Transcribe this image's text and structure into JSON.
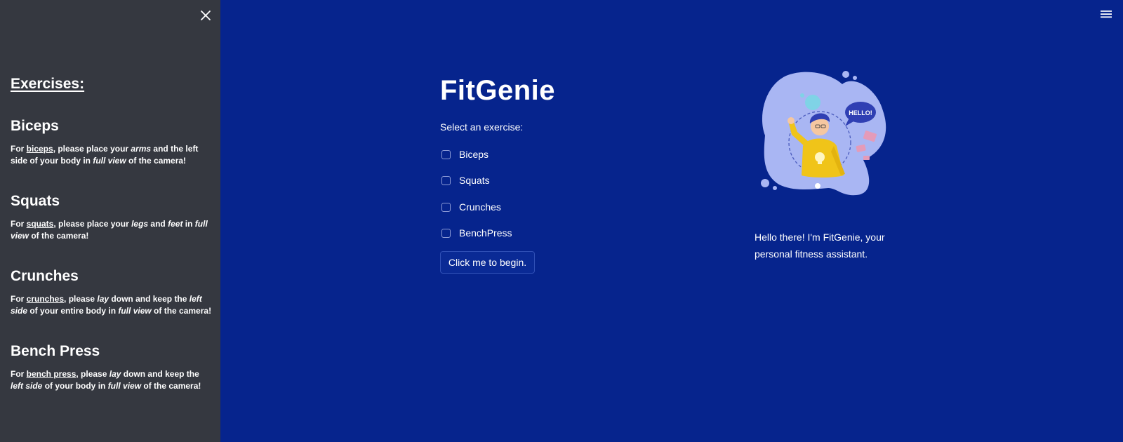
{
  "sidebar": {
    "heading": "Exercises:",
    "exercises": [
      {
        "title": "Biceps",
        "desc_parts": [
          "For ",
          "biceps",
          ", please place your ",
          "arms",
          " and the left side of your body in ",
          "full view",
          " of the camera!"
        ]
      },
      {
        "title": "Squats",
        "desc_parts": [
          "For ",
          "squats",
          ", please place your ",
          "legs",
          " and ",
          "feet",
          " in ",
          "full view",
          " of the camera!"
        ]
      },
      {
        "title": "Crunches",
        "desc_parts": [
          "For ",
          "crunches",
          ", please ",
          "lay",
          " down and keep the ",
          "left side",
          " of your entire body in ",
          "full view",
          " of the camera!"
        ]
      },
      {
        "title": "Bench Press",
        "desc_parts": [
          "For ",
          "bench press",
          ", please ",
          "lay",
          " down and keep the ",
          "left side",
          " of your body in ",
          "full view",
          " of the camera!"
        ]
      }
    ]
  },
  "main": {
    "title": "FitGenie",
    "select_label": "Select an exercise:",
    "options": [
      "Biceps",
      "Squats",
      "Crunches",
      "BenchPress"
    ],
    "begin_button": "Click me to begin.",
    "greeting": "Hello there! I'm FitGenie, your personal fitness assistant.",
    "illustration_bubble_text": "HELLO!"
  },
  "icons": {
    "close": "close-icon",
    "menu": "hamburger-menu-icon"
  },
  "colors": {
    "background": "#06248d",
    "sidebar": "#353840",
    "text": "#ffffff",
    "blob": "#a9b6f3",
    "accent_yellow": "#f0c419"
  }
}
